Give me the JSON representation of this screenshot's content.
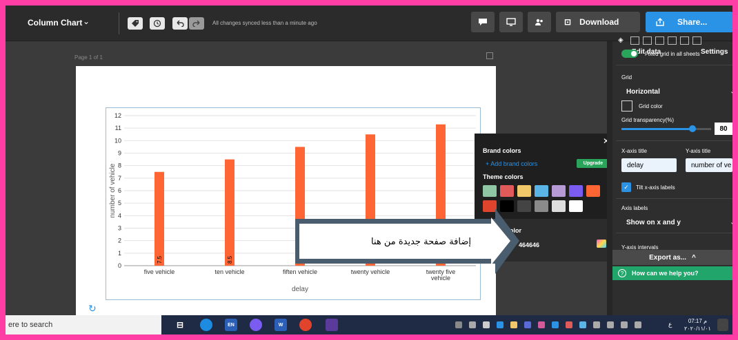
{
  "topbar": {
    "title": "Column Chart",
    "sync_text": "All changes synced less than a minute ago",
    "download_label": "Download",
    "share_label": "Share..."
  },
  "canvas": {
    "page_label": "Page 1 of 1"
  },
  "chart_data": {
    "type": "bar",
    "categories": [
      "five vehicle",
      "ten vehicle",
      "fiften vehicle",
      "twenty vehicle",
      "twenty five vehicle"
    ],
    "values": [
      7.5,
      8.5,
      9.5,
      10.5,
      11.3
    ],
    "data_labels": [
      "7.5",
      "8.5",
      "9.5",
      "",
      ""
    ],
    "xlabel": "delay",
    "ylabel": "number of vehicle",
    "ylim": [
      0,
      12
    ],
    "yticks": [
      0,
      1,
      2,
      3,
      4,
      5,
      6,
      7,
      8,
      9,
      10,
      11,
      12
    ],
    "grid": "horizontal",
    "bar_color": "#ff6633"
  },
  "picker": {
    "brand_colors_title": "Brand colors",
    "add_brand_colors": "+ Add brand colors",
    "upgrade_label": "Upgrade",
    "theme_colors_title": "Theme colors",
    "theme_colors": [
      "#8fc6a4",
      "#e05a5a",
      "#f0c86a",
      "#5ab4e6",
      "#b59ad6",
      "#7b5cf0",
      "#ff6633",
      "#e0442c",
      "#000000",
      "#444444",
      "#8a8a8a",
      "#dddddd",
      "#ffffff"
    ],
    "custom_color_label": "color",
    "custom_color_value": "464646"
  },
  "settings": {
    "tab_edit": "Edit data",
    "tab_settings": "Settings",
    "fixed_grid_label": "Fixed grid in all sheets",
    "grid_label": "Grid",
    "grid_value": "Horizontal",
    "grid_color_label": "Grid color",
    "grid_transparency_label": "Grid transparency(%)",
    "grid_transparency_value": "80",
    "grid_transparency_fraction": 0.8,
    "x_axis_title_label": "X-axis title",
    "y_axis_title_label": "Y-axis title",
    "x_axis_title_value": "delay",
    "y_axis_title_value": "number of ve",
    "tilt_label": "Tilt x-axis labels",
    "axis_labels_label": "Axis labels",
    "axis_labels_value": "Show on x and y",
    "y_axis_intervals_label": "Y-axis intervals",
    "export_label": "Export as...",
    "help_label": "How can we help you?"
  },
  "annotation": {
    "text": "إضافة صفحة جديدة من هنا"
  },
  "taskbar": {
    "search_text": "ere to search",
    "lang": "EN",
    "clock_time": "07:17 م",
    "clock_date": "٢٠٢٠/١١/٠١",
    "tray_letter": "ع"
  },
  "colors": {
    "accent": "#2b93e6",
    "green": "#22a56a",
    "border": "#ff3ea5"
  }
}
